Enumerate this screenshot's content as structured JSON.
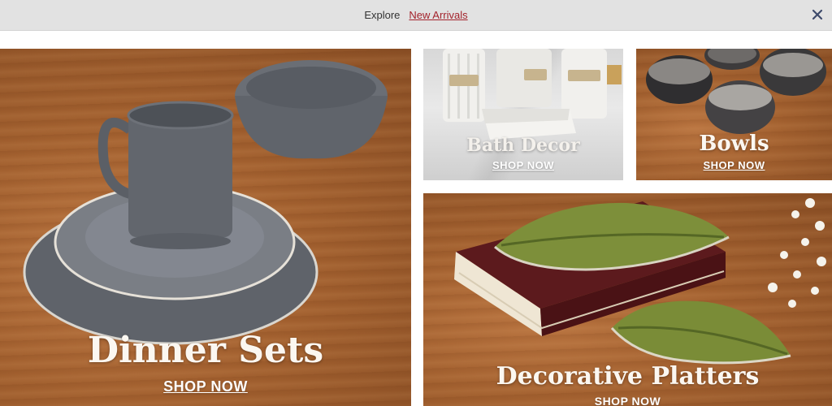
{
  "announcement": {
    "explore_label": "Explore",
    "link_label": "New Arrivals",
    "close_icon": "close-icon"
  },
  "tiles": {
    "dinner_sets": {
      "title": "Dinner Sets",
      "cta": "SHOP NOW"
    },
    "bath_decor": {
      "title": "Bath Decor",
      "cta": "SHOP NOW"
    },
    "bowls": {
      "title": "Bowls",
      "cta": "SHOP NOW"
    },
    "decorative_platters": {
      "title": "Decorative Platters",
      "cta": "SHOP NOW"
    }
  },
  "colors": {
    "link": "#a3232c",
    "banner_bg": "#e2e2e2",
    "wood": "#a2602f",
    "dinnerware": "#6f737a",
    "leaf_green": "#7d8f3a"
  }
}
